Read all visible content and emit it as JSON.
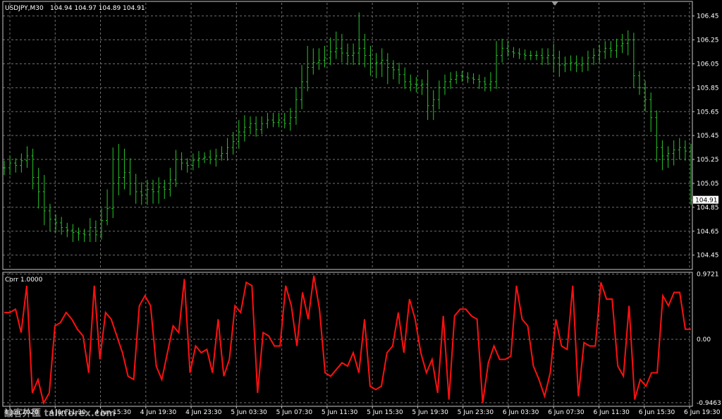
{
  "colors": {
    "background": "#000000",
    "grid": "#6f6f6f",
    "frame": "#c8c8c8",
    "text": "#ffffff",
    "bars": "#29c429",
    "corr_line": "#ff1010",
    "price_tag_bg": "#ffffff",
    "price_tag_text": "#000000"
  },
  "chart_data": [
    {
      "type": "ohlc-bar",
      "symbol_label": "USDJPY,M30",
      "ohlc_label": "104.94 104.97 104.89 104.91",
      "ylim": [
        104.33,
        106.56
      ],
      "yticks": [
        "106.45",
        "106.25",
        "106.05",
        "105.85",
        "105.65",
        "105.45",
        "105.25",
        "105.05",
        "104.85",
        "104.65",
        "104.45"
      ],
      "last_price": "104.91",
      "x": [
        "4 Jun 2020",
        "4 Jun 11:30",
        "4 Jun 15:30",
        "4 Jun 19:30",
        "4 Jun 23:30",
        "5 Jun 03:30",
        "5 Jun 07:30",
        "5 Jun 11:30",
        "5 Jun 15:30",
        "5 Jun 19:30",
        "5 Jun 23:30",
        "6 Jun 03:30",
        "6 Jun 07:30",
        "6 Jun 11:30",
        "6 Jun 15:30",
        "6 Jun 19:30"
      ],
      "close": [
        105.18,
        105.22,
        105.2,
        105.24,
        105.28,
        105.1,
        104.98,
        104.82,
        104.75,
        104.72,
        104.68,
        104.66,
        104.64,
        104.63,
        104.62,
        104.68,
        104.62,
        104.74,
        104.84,
        105.05,
        105.1,
        105.14,
        105.05,
        104.98,
        104.95,
        105.0,
        104.98,
        105.02,
        105.0,
        105.08,
        105.25,
        105.22,
        105.2,
        105.24,
        105.26,
        105.27,
        105.25,
        105.28,
        105.3,
        105.35,
        105.4,
        105.48,
        105.52,
        105.55,
        105.5,
        105.55,
        105.58,
        105.56,
        105.58,
        105.55,
        105.6,
        105.75,
        105.9,
        106.02,
        106.06,
        106.08,
        106.1,
        106.15,
        106.18,
        106.14,
        106.12,
        106.14,
        106.18,
        106.12,
        106.05,
        106.06,
        106.08,
        106.02,
        106.0,
        105.96,
        105.9,
        105.88,
        105.87,
        105.88,
        105.7,
        105.75,
        105.85,
        105.9,
        105.92,
        105.95,
        105.94,
        105.93,
        105.92,
        105.9,
        105.88,
        105.9,
        106.12,
        106.18,
        106.15,
        106.14,
        106.13,
        106.12,
        106.12,
        106.12,
        106.1,
        106.12,
        106.1,
        106.04,
        106.05,
        106.06,
        106.04,
        106.05,
        106.1,
        106.12,
        106.15,
        106.18,
        106.16,
        106.2,
        106.22,
        106.25,
        105.95,
        105.85,
        105.75,
        105.6,
        105.35,
        105.28,
        105.3,
        105.33,
        105.35,
        105.32,
        104.91
      ],
      "high_offset": [
        0.06,
        0.06,
        0.04,
        0.06,
        0.08,
        0.06,
        0.08,
        0.14,
        0.06,
        0.04,
        0.05,
        0.04,
        0.05,
        0.04,
        0.04,
        0.08,
        0.06,
        0.1,
        0.16,
        0.3,
        0.28,
        0.2,
        0.12,
        0.08,
        0.08,
        0.08,
        0.08,
        0.08,
        0.06,
        0.1,
        0.08,
        0.06,
        0.04,
        0.06,
        0.06,
        0.04,
        0.06,
        0.06,
        0.06,
        0.08,
        0.08,
        0.1,
        0.1,
        0.06,
        0.06,
        0.06,
        0.06,
        0.06,
        0.06,
        0.06,
        0.08,
        0.1,
        0.14,
        0.18,
        0.12,
        0.1,
        0.1,
        0.12,
        0.14,
        0.12,
        0.08,
        0.08,
        0.3,
        0.12,
        0.08,
        0.08,
        0.1,
        0.06,
        0.06,
        0.06,
        0.06,
        0.06,
        0.06,
        0.04,
        0.12,
        0.08,
        0.06,
        0.06,
        0.06,
        0.04,
        0.04,
        0.04,
        0.04,
        0.04,
        0.04,
        0.08,
        0.12,
        0.08,
        0.06,
        0.04,
        0.04,
        0.04,
        0.04,
        0.04,
        0.06,
        0.06,
        0.1,
        0.06,
        0.06,
        0.06,
        0.06,
        0.06,
        0.06,
        0.06,
        0.06,
        0.06,
        0.06,
        0.06,
        0.08,
        0.08,
        0.06,
        0.04,
        0.06,
        0.06,
        0.06,
        0.06,
        0.06,
        0.08,
        0.08,
        0.06,
        0.06
      ],
      "low_offset": [
        0.06,
        0.06,
        0.06,
        0.06,
        0.06,
        0.1,
        0.14,
        0.12,
        0.1,
        0.08,
        0.06,
        0.06,
        0.08,
        0.06,
        0.06,
        0.06,
        0.06,
        0.04,
        0.04,
        0.08,
        0.1,
        0.1,
        0.1,
        0.1,
        0.08,
        0.08,
        0.1,
        0.1,
        0.08,
        0.06,
        0.06,
        0.06,
        0.06,
        0.04,
        0.06,
        0.04,
        0.04,
        0.06,
        0.04,
        0.06,
        0.06,
        0.06,
        0.08,
        0.06,
        0.06,
        0.04,
        0.04,
        0.04,
        0.04,
        0.04,
        0.06,
        0.06,
        0.08,
        0.08,
        0.06,
        0.06,
        0.06,
        0.06,
        0.06,
        0.08,
        0.08,
        0.08,
        0.1,
        0.1,
        0.1,
        0.12,
        0.12,
        0.14,
        0.08,
        0.08,
        0.06,
        0.06,
        0.06,
        0.08,
        0.12,
        0.12,
        0.08,
        0.06,
        0.06,
        0.04,
        0.04,
        0.04,
        0.04,
        0.06,
        0.06,
        0.06,
        0.06,
        0.06,
        0.04,
        0.04,
        0.04,
        0.04,
        0.04,
        0.04,
        0.06,
        0.06,
        0.12,
        0.1,
        0.06,
        0.06,
        0.06,
        0.06,
        0.06,
        0.06,
        0.06,
        0.06,
        0.06,
        0.06,
        0.06,
        0.1,
        0.1,
        0.06,
        0.1,
        0.12,
        0.12,
        0.12,
        0.1,
        0.1,
        0.08,
        0.08,
        0.04
      ]
    },
    {
      "type": "line",
      "indicator_label": "Corr 1.0000",
      "ylim": [
        -1.0,
        1.0
      ],
      "yticks": [
        "0.9721",
        "0.00",
        "-0.9463"
      ],
      "values": [
        0.4,
        0.4,
        0.45,
        0.1,
        0.8,
        -0.8,
        -0.6,
        -0.95,
        -0.8,
        0.2,
        0.25,
        0.4,
        0.3,
        0.15,
        0.05,
        -0.5,
        0.8,
        -0.3,
        0.4,
        0.3,
        0.05,
        -0.2,
        -0.55,
        -0.6,
        0.5,
        0.65,
        0.5,
        -0.4,
        -0.6,
        -0.2,
        0.2,
        0.1,
        0.9,
        -0.5,
        -0.1,
        -0.2,
        -0.15,
        -0.5,
        0.3,
        -0.55,
        -0.3,
        0.5,
        0.4,
        0.85,
        0.8,
        -0.8,
        0.1,
        0.05,
        -0.1,
        -0.1,
        0.8,
        0.5,
        -0.1,
        0.7,
        0.3,
        0.95,
        0.45,
        -0.5,
        -0.55,
        -0.45,
        -0.35,
        -0.4,
        -0.2,
        -0.5,
        0.3,
        -0.7,
        -0.75,
        -0.7,
        -0.2,
        -0.1,
        0.4,
        -0.2,
        0.6,
        0.3,
        -0.2,
        -0.5,
        -0.3,
        -0.8,
        0.35,
        -0.9,
        0.35,
        0.45,
        0.45,
        0.35,
        0.3,
        -0.95,
        -0.35,
        -0.1,
        -0.3,
        -0.3,
        -0.25,
        0.8,
        0.3,
        0.2,
        -0.4,
        -0.6,
        -0.85,
        -0.5,
        0.3,
        -0.1,
        -0.15,
        0.8,
        -0.85,
        -0.05,
        -0.1,
        -0.1,
        0.85,
        0.6,
        0.6,
        -0.4,
        -0.55,
        0.5,
        -0.9,
        -0.6,
        -0.7,
        -0.5,
        -0.5,
        0.65,
        0.5,
        0.7,
        0.7,
        0.15,
        0.15
      ]
    }
  ],
  "watermark": "論客外匯 talkforex.com"
}
